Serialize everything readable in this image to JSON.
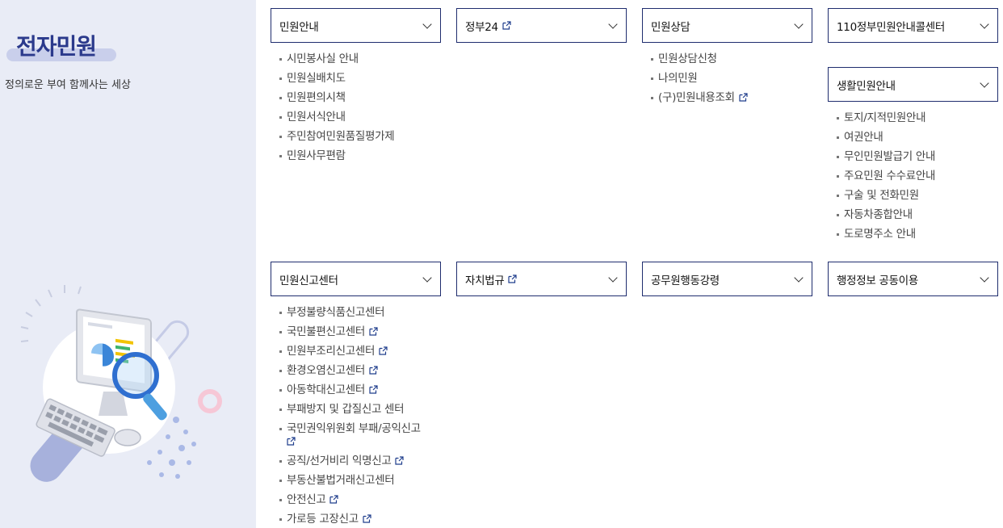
{
  "sidebar": {
    "title": "전자민원",
    "subtitle": "정의로운 부여 함께사는 세상"
  },
  "menus": [
    {
      "label": "민원안내",
      "external": false,
      "items": [
        {
          "label": "시민봉사실 안내",
          "external": false
        },
        {
          "label": "민원실배치도",
          "external": false
        },
        {
          "label": "민원편의시책",
          "external": false
        },
        {
          "label": "민원서식안내",
          "external": false
        },
        {
          "label": "주민참여민원품질평가제",
          "external": false
        },
        {
          "label": "민원사무편람",
          "external": false
        }
      ]
    },
    {
      "label": "정부24",
      "external": true,
      "items": []
    },
    {
      "label": "민원상담",
      "external": false,
      "items": [
        {
          "label": "민원상담신청",
          "external": false
        },
        {
          "label": "나의민원",
          "external": false
        },
        {
          "label": "(구)민원내용조회",
          "external": true
        }
      ]
    },
    {
      "label": "110정부민원안내콜센터",
      "external": false,
      "items": []
    },
    {
      "label": "생활민원안내",
      "external": false,
      "items": [
        {
          "label": "토지/지적민원안내",
          "external": false
        },
        {
          "label": "여권안내",
          "external": false
        },
        {
          "label": "무인민원발급기 안내",
          "external": false
        },
        {
          "label": "주요민원 수수료안내",
          "external": false
        },
        {
          "label": "구술 및 전화민원",
          "external": false
        },
        {
          "label": "자동차종합안내",
          "external": false
        },
        {
          "label": "도로명주소 안내",
          "external": false
        }
      ]
    },
    {
      "label": "민원신고센터",
      "external": false,
      "items": [
        {
          "label": "부정불량식품신고센터",
          "external": false
        },
        {
          "label": "국민불편신고센터",
          "external": true
        },
        {
          "label": "민원부조리신고센터",
          "external": true
        },
        {
          "label": "환경오염신고센터",
          "external": true
        },
        {
          "label": "아동학대신고센터",
          "external": true
        },
        {
          "label": "부패방지 및 갑질신고 센터",
          "external": false
        },
        {
          "label": "국민권익위원회 부패/공익신고",
          "external": true,
          "wrap": true
        },
        {
          "label": "공직/선거비리 익명신고",
          "external": true
        },
        {
          "label": "부동산불법거래신고센터",
          "external": false
        },
        {
          "label": "안전신고",
          "external": true
        },
        {
          "label": "가로등 고장신고",
          "external": true
        }
      ]
    },
    {
      "label": "자치법규",
      "external": true,
      "items": []
    },
    {
      "label": "공무원행동강령",
      "external": false,
      "items": []
    },
    {
      "label": "행정정보 공동이용",
      "external": false,
      "items": []
    }
  ]
}
